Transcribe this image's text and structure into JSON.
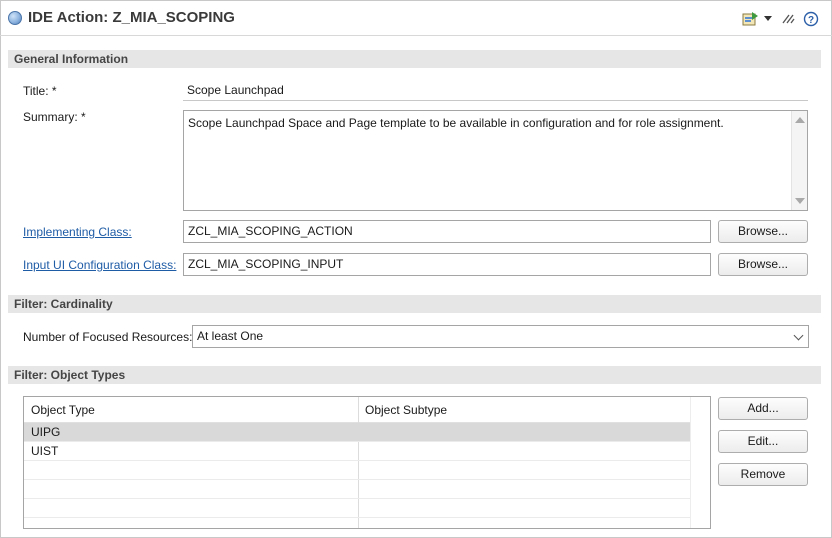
{
  "header": {
    "title": "IDE Action: Z_MIA_SCOPING",
    "icons": [
      "object-status-icon",
      "run-icon",
      "dropdown-arrow-icon",
      "collapse-icon",
      "help-icon"
    ],
    "help_label": "?"
  },
  "general": {
    "section_title": "General Information",
    "title_label": "Title: *",
    "title_value": "Scope Launchpad",
    "summary_label": "Summary: *",
    "summary_value": "Scope Launchpad Space and Page template to be available in configuration and for role assignment.",
    "impl_class_label": "Implementing Class:",
    "impl_class_value": "ZCL_MIA_SCOPING_ACTION",
    "input_ui_label": "Input UI Configuration Class:",
    "input_ui_value": "ZCL_MIA_SCOPING_INPUT",
    "browse_label": "Browse..."
  },
  "cardinality": {
    "section_title": "Filter: Cardinality",
    "focused_label": "Number of Focused Resources:",
    "focused_value": "At least One"
  },
  "object_types": {
    "section_title": "Filter: Object Types",
    "columns": [
      "Object Type",
      "Object Subtype"
    ],
    "rows": [
      {
        "type": "UIPG",
        "subtype": "",
        "selected": true
      },
      {
        "type": "UIST",
        "subtype": "",
        "selected": false
      }
    ],
    "add_label": "Add...",
    "edit_label": "Edit...",
    "remove_label": "Remove"
  },
  "colors": {
    "link": "#1f5ca6",
    "section_bg": "#e6e6e6",
    "selected_row": "#d9d9d9"
  }
}
